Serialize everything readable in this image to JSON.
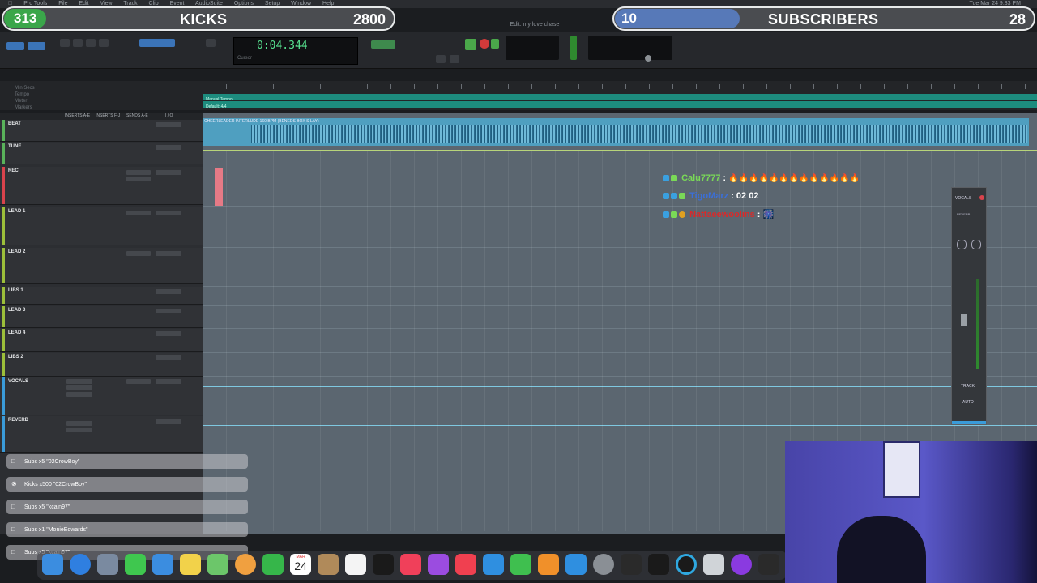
{
  "menubar": {
    "items": [
      "Pro Tools",
      "File",
      "Edit",
      "View",
      "Track",
      "Clip",
      "Event",
      "AudioSuite",
      "Options",
      "Setup",
      "Window",
      "Help"
    ],
    "clock": "Tue Mar 24  9:33 PM"
  },
  "overlay": {
    "kicks": {
      "left_num": "313",
      "label": "KICKS",
      "count": "2800"
    },
    "subs": {
      "left_num": "10",
      "label": "SUBSCRIBERS",
      "count": "28"
    }
  },
  "window_title": "Edit: my love chase",
  "counter": {
    "time": "0:04.344",
    "label": "Cursor"
  },
  "ruler": {
    "labels": [
      "Min:Secs",
      "Tempo",
      "Meter",
      "Markers"
    ],
    "tempo_text": "Manual Tempo",
    "meter_text": "Default: 4/4"
  },
  "columns": [
    "INSERTS A-E",
    "INSERTS F-J",
    "SENDS A-E",
    "I / O"
  ],
  "tracks": [
    {
      "name": "BEAT",
      "color": "#59b25a"
    },
    {
      "name": "TUNE",
      "color": "#59b25a"
    },
    {
      "name": "REC",
      "color": "#d9434c"
    },
    {
      "name": "LEAD 1",
      "color": "#9cbf3a"
    },
    {
      "name": "LEAD 2",
      "color": "#9cbf3a"
    },
    {
      "name": "LIBS 1",
      "color": "#9cbf3a"
    },
    {
      "name": "LEAD 3",
      "color": "#9cbf3a"
    },
    {
      "name": "LEAD 4",
      "color": "#9cbf3a"
    },
    {
      "name": "LIBS 2",
      "color": "#9cbf3a"
    },
    {
      "name": "VOCALS",
      "color": "#3a9bd9"
    },
    {
      "name": "REVERB",
      "color": "#3a9bd9"
    }
  ],
  "clip": {
    "name": "CHEERLEADER INTERLUDE 160 BPM (BENEDS BOX S LAY)"
  },
  "chat": [
    {
      "user": "Calu7777",
      "user_color": "#7ad957",
      "message": "🔥🔥🔥🔥🔥🔥🔥🔥🔥🔥🔥🔥🔥",
      "msg_color": "#ffffff"
    },
    {
      "user": "TigoMarz",
      "user_color": "#3b6fd9",
      "message": "02 02",
      "msg_color": "#ffffff"
    },
    {
      "user": "Nattaeewoolins",
      "user_color": "#d92a2a",
      "message": "🎆",
      "msg_color": "#ffffff"
    }
  ],
  "strip": {
    "name": "VOCALS",
    "track_label": "TRACK",
    "auto_label": "AUTO",
    "send_label": "REVERB"
  },
  "notifications": [
    {
      "icon": "gift-icon",
      "text": "Subs x5 \"02CrowBoy\""
    },
    {
      "icon": "kick-icon",
      "text": "Kicks x500 \"02CrowBoy\""
    },
    {
      "icon": "gift-icon",
      "text": "Subs x5 \"kcain97\""
    },
    {
      "icon": "gift-icon",
      "text": "Subs x1 \"MonieEdwards\""
    },
    {
      "icon": "gift-icon",
      "text": "Subs x5 \"kcain97\""
    }
  ],
  "dock": {
    "calendar_month": "MAR",
    "calendar_day": "24"
  }
}
